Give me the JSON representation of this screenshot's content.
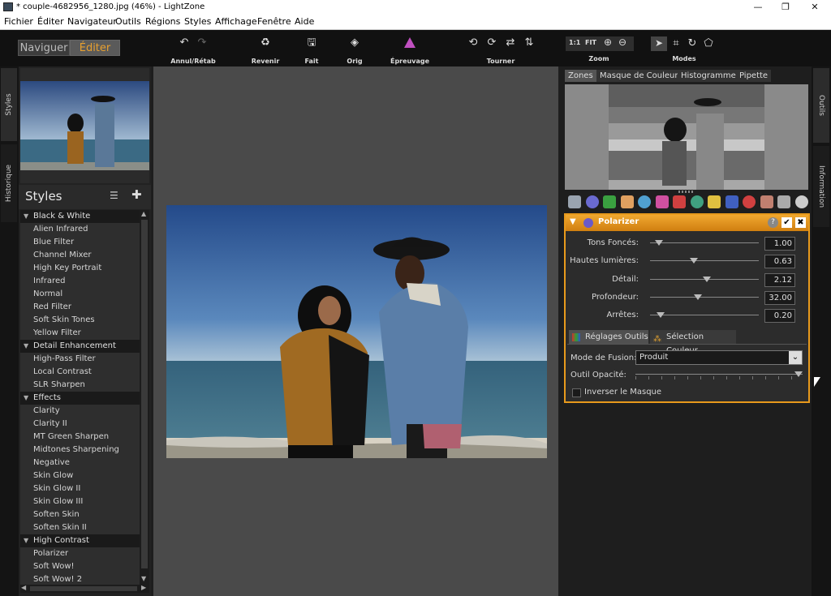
{
  "window": {
    "title": "* couple-4682956_1280.jpg (46%) - LightZone",
    "min": "—",
    "max": "❐",
    "close": "✕"
  },
  "menu": [
    "Fichier",
    "Éditer",
    "Navigateur",
    "Outils",
    "Régions",
    "Styles",
    "Affichage",
    "Fenêtre",
    "Aide"
  ],
  "toolbar": {
    "nav": "Naviguer",
    "edit": "Éditer",
    "undo_label": "Annul/Rétab",
    "revert_label": "Revenir",
    "done_label": "Fait",
    "orig_label": "Orig",
    "proof_label": "Épreuvage",
    "rotate_label": "Tourner",
    "zoom_label": "Zoom",
    "modes_label": "Modes",
    "zoom_1to1": "1:1",
    "zoom_fit": "FIT"
  },
  "left_tabs": {
    "styles": "Styles",
    "history": "Historique"
  },
  "right_tabs": {
    "tools": "Outils",
    "info": "Information"
  },
  "styles_panel": {
    "title": "Styles",
    "groups": [
      {
        "name": "Black & White",
        "items": [
          "Alien Infrared",
          "Blue Filter",
          "Channel Mixer",
          "High Key Portrait",
          "Infrared",
          "Normal",
          "Red Filter",
          "Soft Skin Tones",
          "Yellow Filter"
        ]
      },
      {
        "name": "Detail Enhancement",
        "items": [
          "High-Pass Filter",
          "Local Contrast",
          "SLR Sharpen"
        ]
      },
      {
        "name": "Effects",
        "items": [
          "Clarity",
          "Clarity II",
          "MT Green Sharpen",
          "Midtones Sharpening",
          "Negative",
          "Skin Glow",
          "Skin Glow II",
          "Skin Glow III",
          "Soften Skin",
          "Soften Skin II"
        ]
      },
      {
        "name": "High Contrast",
        "items": [
          "Polarizer",
          "Soft Wow!",
          "Soft Wow! 2"
        ]
      }
    ]
  },
  "zone_tabs": [
    "Zones",
    "Masque de Couleur",
    "Histogramme",
    "Pipette"
  ],
  "tool_icon_colors": [
    "#9aa4b0",
    "#6a6ad0",
    "#3aa040",
    "#e0a060",
    "#50a0d0",
    "#d050a0",
    "#d04040",
    "#40a080",
    "#e0c040",
    "#4060c0",
    "#d04040",
    "#c08070",
    "#aaaaaa",
    "#cccccc"
  ],
  "polarizer": {
    "title": "Polarizer",
    "sliders": [
      {
        "label": "Tons Foncés:",
        "value": "1.00",
        "pos": 0.08
      },
      {
        "label": "Hautes lumières:",
        "value": "0.63",
        "pos": 0.4
      },
      {
        "label": "Détail:",
        "value": "2.12",
        "pos": 0.52
      },
      {
        "label": "Profondeur:",
        "value": "32.00",
        "pos": 0.44
      },
      {
        "label": "Arrêtes:",
        "value": "0.20",
        "pos": 0.1
      }
    ],
    "tab_tools": "Réglages Outils",
    "tab_color": "Sélection Couleur",
    "blend_label": "Mode de Fusion:",
    "blend_value": "Produit",
    "opacity_label": "Outil Opacité:",
    "opacity": 1.0,
    "invert_label": "Inverser le Masque"
  }
}
